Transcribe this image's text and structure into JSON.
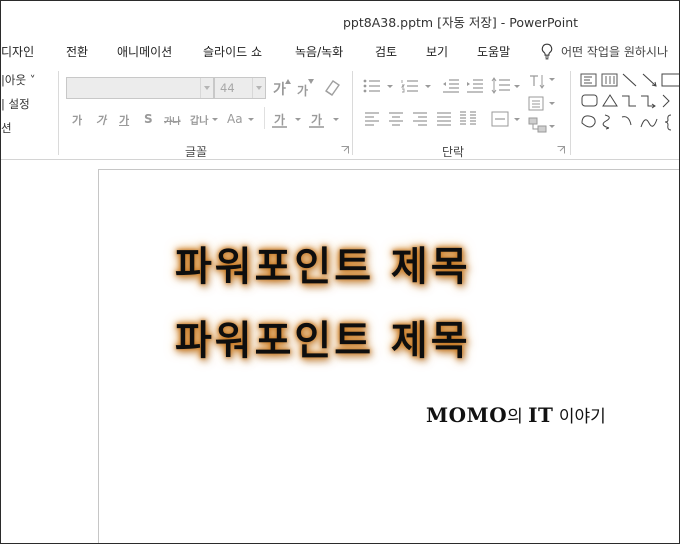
{
  "window": {
    "title": "ppt8A38.pptm [자동 저장]  -  PowerPoint"
  },
  "tabs": [
    "디자인",
    "전환",
    "애니메이션",
    "슬라이드 쇼",
    "녹음/녹화",
    "검토",
    "보기",
    "도움말"
  ],
  "tell_me": {
    "placeholder": "어떤 작업을 원하시나"
  },
  "ribbon": {
    "slides_group": {
      "layout_label": "|아웃 ˅",
      "reset_label": "| 설정",
      "section_label": "션"
    },
    "font_group": {
      "label": "글꼴",
      "font_name_value": "",
      "font_size_value": "44",
      "grow_glyph": "가",
      "shrink_glyph": "가",
      "bold_glyph": "가",
      "italic_glyph": "가",
      "underline_glyph": "가",
      "shadow_glyph": "S",
      "strike_glyph": "가나",
      "spacing_glyph": "갑나",
      "case_glyph": "Aa",
      "highlight_glyph": "가",
      "font_color_glyph": "가"
    },
    "paragraph_group": {
      "label": "단락"
    }
  },
  "slide": {
    "title_line1": "파워포인트 제목",
    "title_line2": "파워포인트 제목",
    "subtitle_en": "MOMO",
    "subtitle_ko1": "의 ",
    "subtitle_en2": "IT",
    "subtitle_ko2": " 이야기"
  },
  "colors": {
    "title_glow": "#d88a2e",
    "ribbon_disabled": "#9a9a9a",
    "border": "#2b2b2b"
  }
}
